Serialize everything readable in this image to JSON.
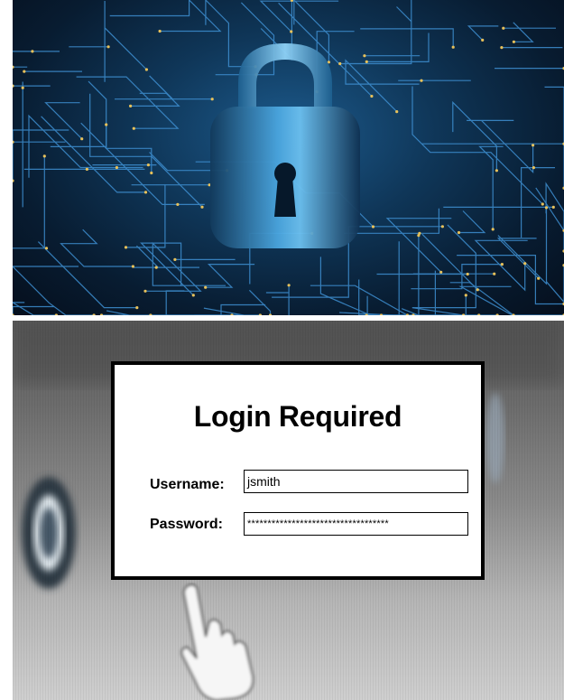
{
  "banner": {
    "illustration": "padlock-on-circuit-board",
    "colors": {
      "background": "#0b2a47",
      "trace": "#3e8fd1",
      "lock": "#4aa5de"
    }
  },
  "login": {
    "title": "Login Required",
    "username_label": "Username:",
    "username_value": "jsmith",
    "password_label": "Password:",
    "password_value": "***********************************"
  },
  "pointer": {
    "icon": "hand-cursor-icon"
  }
}
